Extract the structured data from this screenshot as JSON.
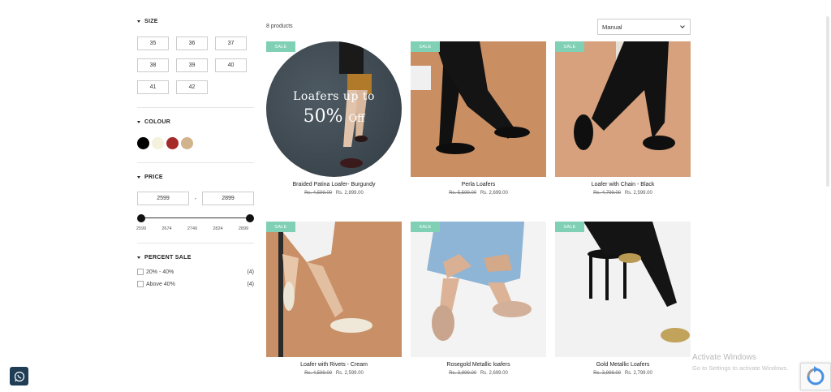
{
  "filters": {
    "size": {
      "title": "SIZE",
      "options": [
        "35",
        "36",
        "37",
        "38",
        "39",
        "40",
        "41",
        "42"
      ]
    },
    "colour": {
      "title": "COLOUR",
      "swatches": [
        "#000000",
        "#f4f1dc",
        "#a52a2a",
        "#d2b48c"
      ]
    },
    "price": {
      "title": "PRICE",
      "min": "2599",
      "max": "2899",
      "dash": "-",
      "ticks": [
        "2599",
        "2674",
        "2749",
        "2824",
        "2899"
      ]
    },
    "percent_sale": {
      "title": "PERCENT SALE",
      "options": [
        {
          "label": "20% - 40%",
          "count": "(4)"
        },
        {
          "label": "Above 40%",
          "count": "(4)"
        }
      ]
    }
  },
  "toolbar": {
    "count": "8 products",
    "sort_value": "Manual"
  },
  "promo": {
    "line1": "Loafers up to",
    "line2_big": "50%",
    "line2_small": "Off"
  },
  "products": [
    {
      "badge": "SALE",
      "name": "Braided Patina Loafer- Burgundy",
      "old_price": "Rs. 4,599.00",
      "new_price": "Rs. 2,899.00"
    },
    {
      "badge": "SALE",
      "name": "Perla Loafers",
      "old_price": "Rs. 5,599.00",
      "new_price": "Rs. 2,699.00"
    },
    {
      "badge": "SALE",
      "name": "Loafer with Chain - Black",
      "old_price": "Rs. 4,799.00",
      "new_price": "Rs. 2,599.00"
    },
    {
      "badge": "SALE",
      "name": "Loafer with Rivets - Cream",
      "old_price": "Rs. 4,599.00",
      "new_price": "Rs. 2,599.00"
    },
    {
      "badge": "SALE",
      "name": "Rosegold Metallic loafers",
      "old_price": "Rs. 3,999.00",
      "new_price": "Rs. 2,699.00"
    },
    {
      "badge": "SALE",
      "name": "Gold Metallic Loafers",
      "old_price": "Rs. 3,999.00",
      "new_price": "Rs. 2,799.00"
    }
  ],
  "overlay": {
    "activate_title": "Activate Windows",
    "activate_sub": "Go to Settings to activate Windows."
  }
}
